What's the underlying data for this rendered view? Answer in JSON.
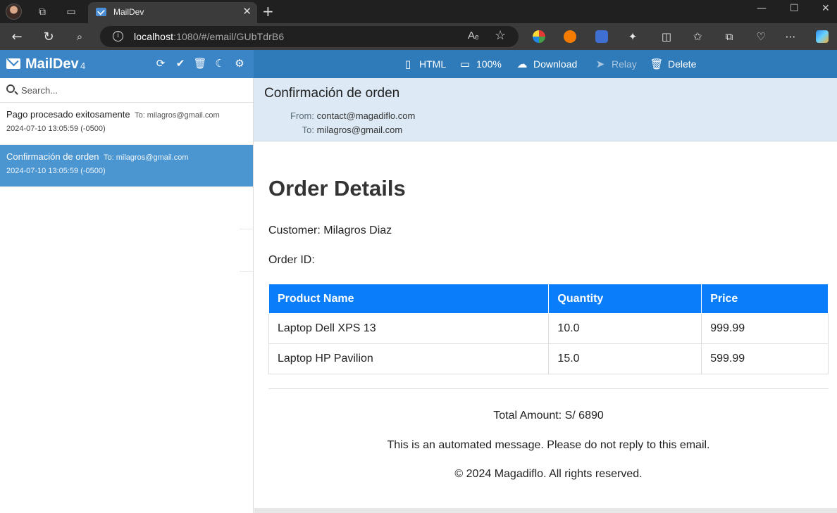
{
  "browser": {
    "tab_title": "MailDev",
    "tab_close": "✕",
    "new_tab": "+",
    "url_host": "localhost",
    "url_path": ":1080/#/email/GUbTdrB6",
    "read_aloud": "Aₑ",
    "icons": [
      "profile-avatar",
      "workspaces-icon",
      "tab-actions-icon",
      "back-icon",
      "refresh-icon",
      "search-icon",
      "site-info-icon",
      "read-aloud-icon",
      "favorite-star-icon",
      "extensions-icon",
      "split-screen-icon",
      "favorites-icon",
      "collections-icon",
      "browser-essentials-icon",
      "more-icon",
      "copilot-icon"
    ]
  },
  "app": {
    "brand": "MailDev",
    "count": "4",
    "search_placeholder": "Search...",
    "emails": [
      {
        "subject": "Pago procesado exitosamente",
        "to": "To: milagros@gmail.com",
        "date": "2024-07-10 13:05:59 (-0500)",
        "selected": false
      },
      {
        "subject": "Confirmación de orden",
        "to": "To: milagros@gmail.com",
        "date": "2024-07-10 13:05:59 (-0500)",
        "selected": true
      }
    ],
    "toolbar": {
      "html": "HTML",
      "zoom": "100%",
      "download": "Download",
      "relay": "Relay",
      "delete": "Delete"
    },
    "header_tools": [
      "refresh-icon",
      "mark-all-read-icon",
      "delete-all-icon",
      "dark-mode-icon",
      "settings-icon"
    ],
    "colors": {
      "sidebar_header": "#3b85c6",
      "toolbar": "#2f7ab8",
      "selected_item": "#4b95d1",
      "email_header_bg": "#dde9f4",
      "table_header": "#0a7dfb"
    }
  },
  "email": {
    "subject": "Confirmación de orden",
    "from_label": "From:",
    "from": "contact@magadiflo.com",
    "to_label": "To:",
    "to": "milagros@gmail.com",
    "body": {
      "title": "Order Details",
      "customer": "Customer: Milagros Diaz",
      "order_id": "Order ID:",
      "columns": [
        "Product Name",
        "Quantity",
        "Price"
      ],
      "rows": [
        [
          "Laptop Dell XPS 13",
          "10.0",
          "999.99"
        ],
        [
          "Laptop HP Pavilion",
          "15.0",
          "599.99"
        ]
      ],
      "total": "Total Amount: S/ 6890",
      "notice": "This is an automated message. Please do not reply to this email.",
      "copyright": "© 2024 Magadiflo. All rights reserved."
    }
  }
}
